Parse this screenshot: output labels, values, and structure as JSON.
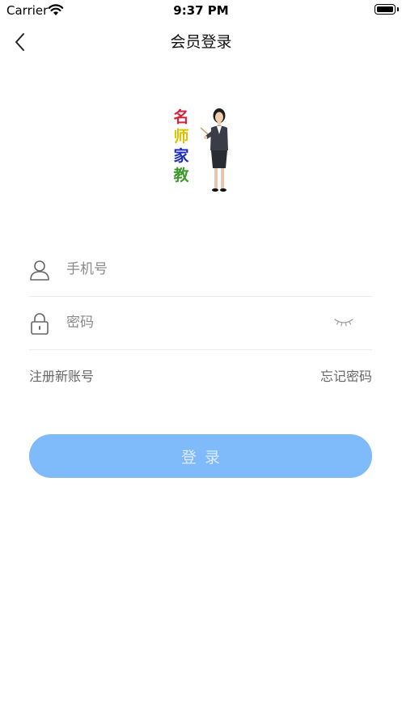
{
  "status_bar": {
    "carrier": "Carrier",
    "time": "9:37 PM"
  },
  "nav": {
    "title": "会员登录",
    "back_icon": "chevron-left-icon"
  },
  "logo": {
    "chars": [
      "名",
      "师",
      "家",
      "教"
    ],
    "char_colors": [
      "#d4233a",
      "#d9c200",
      "#1f2fb5",
      "#3c9a2c"
    ]
  },
  "form": {
    "phone": {
      "icon": "user-icon",
      "placeholder": "手机号",
      "value": ""
    },
    "password": {
      "icon": "lock-icon",
      "placeholder": "密码",
      "value": "",
      "toggle_icon": "eye-closed-icon"
    }
  },
  "links": {
    "register": "注册新账号",
    "forgot": "忘记密码"
  },
  "login_button": {
    "label": "登录",
    "color": "#7fbafa"
  }
}
